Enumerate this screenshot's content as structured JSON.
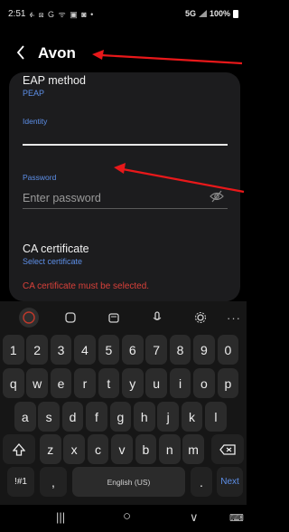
{
  "status": {
    "time": "2:51",
    "icons": "ፉ ⊠ G ᯤ ▣ ◙ •",
    "network": "5G",
    "battery": "100%"
  },
  "header": {
    "title": "Avon"
  },
  "form": {
    "eap_method": {
      "label": "EAP method",
      "value": "PEAP"
    },
    "identity": {
      "label": "Identity",
      "value": ""
    },
    "password": {
      "label": "Password",
      "placeholder": "Enter password"
    },
    "ca_certificate": {
      "label": "CA certificate",
      "value": "Select certificate"
    },
    "error": "CA certificate must be selected."
  },
  "annotations": {
    "arrow_color": "#e8181a"
  },
  "keyboard": {
    "number_row": [
      "1",
      "2",
      "3",
      "4",
      "5",
      "6",
      "7",
      "8",
      "9",
      "0"
    ],
    "row1": [
      "q",
      "w",
      "e",
      "r",
      "t",
      "y",
      "u",
      "i",
      "o",
      "p"
    ],
    "row2": [
      "a",
      "s",
      "d",
      "f",
      "g",
      "h",
      "j",
      "k",
      "l"
    ],
    "row3": [
      "z",
      "x",
      "c",
      "v",
      "b",
      "n",
      "m"
    ],
    "symbols_label": "!#1",
    "comma_label": ",",
    "space_label": "English (US)",
    "period_label": ".",
    "next_label": "Next",
    "toolbar_more": "···"
  },
  "navbar": {
    "recent": "|||",
    "home": "○",
    "back": "∨",
    "keyboard": "⌨"
  }
}
